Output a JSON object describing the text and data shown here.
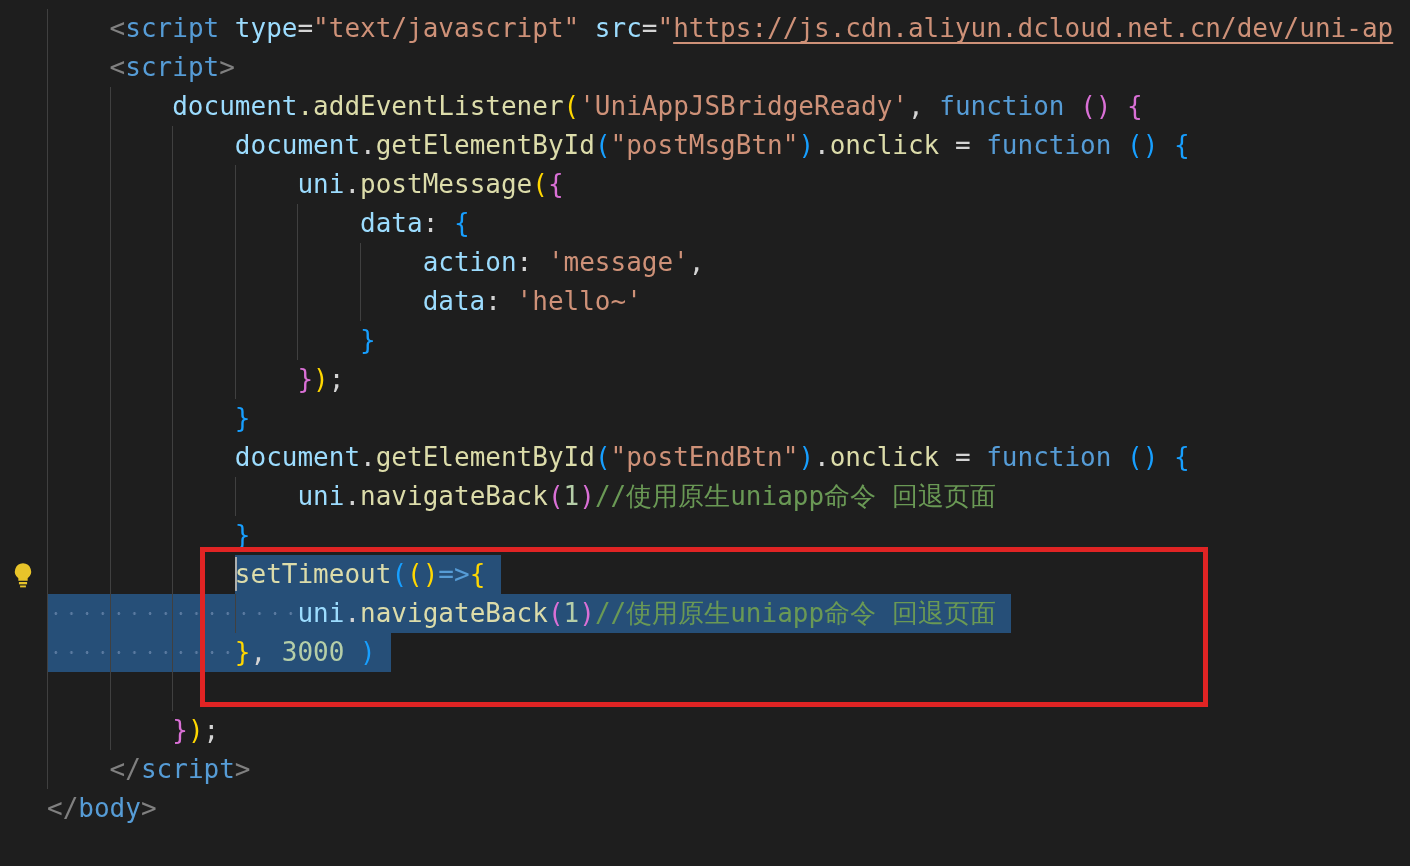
{
  "editor": {
    "lines": [
      {
        "kind": "block",
        "children": [
          {
            "kind": "code",
            "tokens": [
              {
                "kind": "tag",
                "text": "<"
              },
              {
                "kind": "tagname",
                "text": "script"
              },
              {
                "kind": "attr",
                "space": true,
                "text": "type"
              },
              {
                "kind": "punct",
                "text": "="
              },
              {
                "kind": "str",
                "text": "\"text/javascript\""
              },
              {
                "kind": "attr",
                "space": true,
                "text": "src"
              },
              {
                "kind": "punct",
                "text": "="
              },
              {
                "kind": "str",
                "text": "\""
              },
              {
                "kind": "link",
                "text": "https://js.cdn.aliyun.dcloud.net.cn/dev/uni-ap"
              }
            ]
          },
          {
            "kind": "code",
            "tokens": [
              {
                "kind": "tag",
                "text": "<"
              },
              {
                "kind": "tagname",
                "text": "script"
              },
              {
                "kind": "tag",
                "text": ">"
              }
            ],
            "children": [
              {
                "kind": "code",
                "tokens": [
                  {
                    "kind": "var",
                    "text": "document"
                  },
                  {
                    "kind": "fn",
                    "text": ".addEventListener"
                  },
                  {
                    "kind": "b1",
                    "text": "("
                  },
                  {
                    "kind": "str",
                    "text": "'UniAppJSBridgeReady'"
                  },
                  {
                    "kind": "punct",
                    "text": ","
                  },
                  {
                    "kind": "kw",
                    "space": true,
                    "text": "function"
                  },
                  {
                    "kind": "b2",
                    "space": true,
                    "text": "()"
                  },
                  {
                    "kind": "b2",
                    "space": true,
                    "text": "{"
                  }
                ],
                "children": [
                  {
                    "kind": "code",
                    "tokens": [
                      {
                        "kind": "var",
                        "text": "document"
                      },
                      {
                        "kind": "punct",
                        "text": "."
                      },
                      {
                        "kind": "fn",
                        "text": "getElementById"
                      },
                      {
                        "kind": "b3",
                        "text": "("
                      },
                      {
                        "kind": "str",
                        "text": "\"postMsgBtn\""
                      },
                      {
                        "kind": "b3",
                        "text": ")"
                      },
                      {
                        "kind": "punct",
                        "text": "."
                      },
                      {
                        "kind": "fn",
                        "text": "onclick"
                      },
                      {
                        "kind": "punct",
                        "space": true,
                        "text": "="
                      },
                      {
                        "kind": "kw",
                        "space": true,
                        "text": "function"
                      },
                      {
                        "kind": "b3",
                        "space": true,
                        "text": "()"
                      },
                      {
                        "kind": "b3",
                        "space": true,
                        "text": "{"
                      }
                    ],
                    "children": [
                      {
                        "kind": "code",
                        "tokens": [
                          {
                            "kind": "var",
                            "text": "uni"
                          },
                          {
                            "kind": "punct",
                            "text": "."
                          },
                          {
                            "kind": "fn",
                            "text": "postMessage"
                          },
                          {
                            "kind": "b1",
                            "text": "("
                          },
                          {
                            "kind": "b2",
                            "text": "{"
                          }
                        ],
                        "children": [
                          {
                            "kind": "code",
                            "tokens": [
                              {
                                "kind": "var",
                                "text": "data"
                              },
                              {
                                "kind": "punct",
                                "text": ":"
                              },
                              {
                                "kind": "b3",
                                "space": true,
                                "text": "{"
                              }
                            ],
                            "children": [
                              {
                                "kind": "code",
                                "tokens": [
                                  {
                                    "kind": "var",
                                    "text": "action"
                                  },
                                  {
                                    "kind": "punct",
                                    "text": ":"
                                  },
                                  {
                                    "kind": "str",
                                    "space": true,
                                    "text": "'message'"
                                  },
                                  {
                                    "kind": "punct",
                                    "text": ","
                                  }
                                ]
                              },
                              {
                                "kind": "code",
                                "tokens": [
                                  {
                                    "kind": "var",
                                    "text": "data"
                                  },
                                  {
                                    "kind": "punct",
                                    "text": ":"
                                  },
                                  {
                                    "kind": "str",
                                    "space": true,
                                    "text": "'hello~'"
                                  }
                                ]
                              }
                            ]
                          },
                          {
                            "kind": "code",
                            "tokens": [
                              {
                                "kind": "b3",
                                "text": "}"
                              }
                            ]
                          }
                        ]
                      },
                      {
                        "kind": "code",
                        "tokens": [
                          {
                            "kind": "b2",
                            "text": "}"
                          },
                          {
                            "kind": "b1",
                            "text": ")"
                          },
                          {
                            "kind": "punct",
                            "text": ";"
                          }
                        ]
                      }
                    ]
                  },
                  {
                    "kind": "code",
                    "tokens": [
                      {
                        "kind": "b3",
                        "text": "}"
                      }
                    ]
                  },
                  {
                    "kind": "code",
                    "tokens": [
                      {
                        "kind": "var",
                        "text": "document"
                      },
                      {
                        "kind": "punct",
                        "text": "."
                      },
                      {
                        "kind": "fn",
                        "text": "getElementById"
                      },
                      {
                        "kind": "b3",
                        "text": "("
                      },
                      {
                        "kind": "str",
                        "text": "\"postEndBtn\""
                      },
                      {
                        "kind": "b3",
                        "text": ")"
                      },
                      {
                        "kind": "punct",
                        "text": "."
                      },
                      {
                        "kind": "fn",
                        "text": "onclick"
                      },
                      {
                        "kind": "punct",
                        "space": true,
                        "text": "="
                      },
                      {
                        "kind": "kw",
                        "space": true,
                        "text": "function"
                      },
                      {
                        "kind": "b3",
                        "space": true,
                        "text": "()"
                      },
                      {
                        "kind": "b3",
                        "space": true,
                        "text": "{"
                      }
                    ],
                    "children": [
                      {
                        "kind": "code",
                        "tokens": [
                          {
                            "kind": "var",
                            "text": "uni"
                          },
                          {
                            "kind": "punct",
                            "text": "."
                          },
                          {
                            "kind": "fn",
                            "text": "navigateBack"
                          },
                          {
                            "kind": "b2",
                            "text": "("
                          },
                          {
                            "kind": "num",
                            "text": "1"
                          },
                          {
                            "kind": "b2",
                            "text": ")"
                          },
                          {
                            "kind": "comment",
                            "text": "//使用原生uniapp命令 回退页面"
                          }
                        ]
                      }
                    ]
                  },
                  {
                    "kind": "code",
                    "tokens": [
                      {
                        "kind": "b3",
                        "text": "}"
                      }
                    ]
                  },
                  {
                    "kind": "code",
                    "lightbulb": true,
                    "cursor": true,
                    "selected": true,
                    "tokens": [
                      {
                        "kind": "fn",
                        "text": "setTimeout"
                      },
                      {
                        "kind": "b3",
                        "text": "("
                      },
                      {
                        "kind": "b1",
                        "text": "()"
                      },
                      {
                        "kind": "kw",
                        "text": "=>"
                      },
                      {
                        "kind": "b1",
                        "text": "{"
                      }
                    ],
                    "children": [
                      {
                        "kind": "code",
                        "selected": true,
                        "tokens": [
                          {
                            "kind": "var",
                            "text": "uni"
                          },
                          {
                            "kind": "punct",
                            "text": "."
                          },
                          {
                            "kind": "fn",
                            "text": "navigateBack"
                          },
                          {
                            "kind": "b2",
                            "text": "("
                          },
                          {
                            "kind": "num",
                            "text": "1"
                          },
                          {
                            "kind": "b2",
                            "text": ")"
                          },
                          {
                            "kind": "comment",
                            "text": "//使用原生uniapp命令 回退页面"
                          }
                        ]
                      }
                    ]
                  },
                  {
                    "kind": "code",
                    "selected": true,
                    "tokens": [
                      {
                        "kind": "b1",
                        "text": "}"
                      },
                      {
                        "kind": "punct",
                        "text": ","
                      },
                      {
                        "kind": "num",
                        "space": true,
                        "text": "3000"
                      },
                      {
                        "kind": "b3",
                        "space": true,
                        "text": ")"
                      }
                    ]
                  },
                  {
                    "kind": "blank"
                  }
                ]
              },
              {
                "kind": "code",
                "tokens": [
                  {
                    "kind": "b2",
                    "text": "}"
                  },
                  {
                    "kind": "b1",
                    "text": ")"
                  },
                  {
                    "kind": "punct",
                    "text": ";"
                  }
                ]
              }
            ]
          },
          {
            "kind": "code",
            "tokens": [
              {
                "kind": "tag",
                "text": "</"
              },
              {
                "kind": "tagname",
                "text": "script"
              },
              {
                "kind": "tag",
                "text": ">"
              }
            ]
          }
        ]
      },
      {
        "kind": "code",
        "tokens": [
          {
            "kind": "tag",
            "text": "</"
          },
          {
            "kind": "tagname",
            "text": "body"
          },
          {
            "kind": "tag",
            "text": ">"
          }
        ]
      }
    ]
  }
}
